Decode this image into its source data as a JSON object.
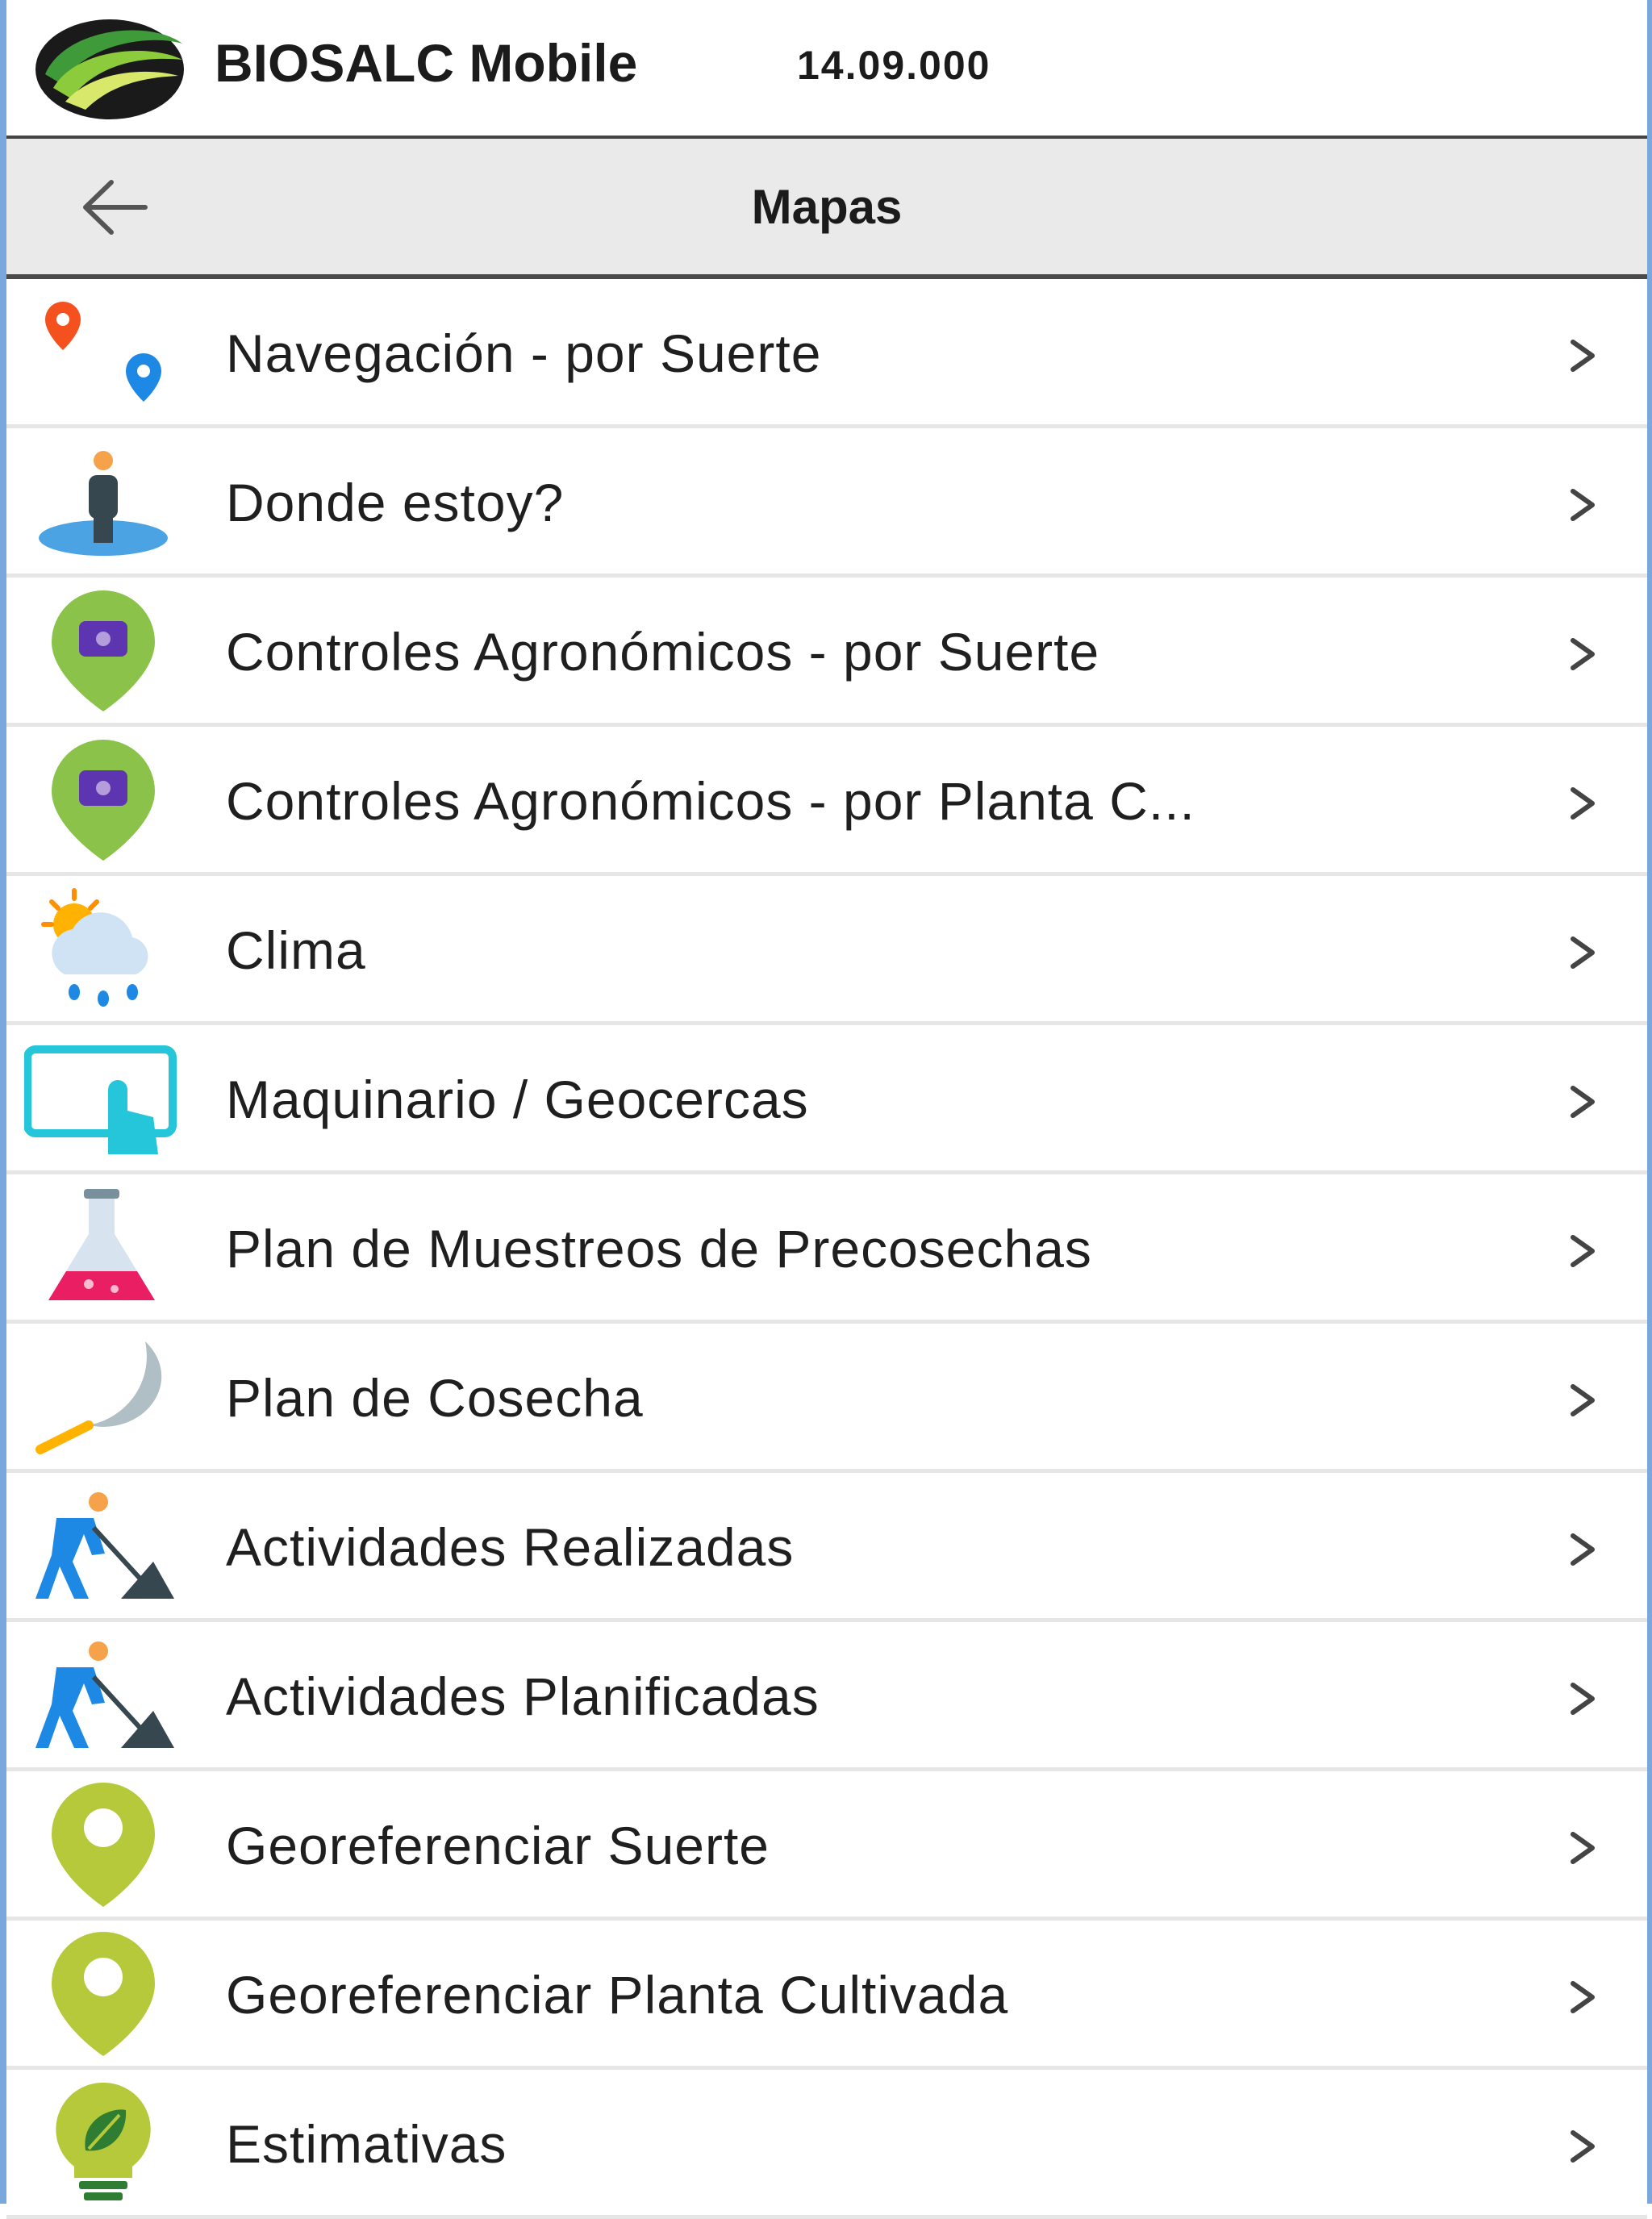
{
  "app": {
    "title": "BIOSALC Mobile",
    "version": "14.09.000"
  },
  "toolbar": {
    "title": "Mapas",
    "back_icon": "arrow-left-icon"
  },
  "menu": {
    "items": [
      {
        "label": "Navegación - por Suerte",
        "icon": "map-pins-icon"
      },
      {
        "label": "Donde estoy?",
        "icon": "person-location-icon"
      },
      {
        "label": "Controles Agronómicos - por Suerte",
        "icon": "green-pin-camera-icon"
      },
      {
        "label": "Controles Agronómicos - por Planta C...",
        "icon": "green-pin-camera-icon"
      },
      {
        "label": "Clima",
        "icon": "weather-icon"
      },
      {
        "label": "Maquinario / Geocercas",
        "icon": "touch-screen-icon"
      },
      {
        "label": "Plan de Muestreos de Precosechas",
        "icon": "flask-icon"
      },
      {
        "label": "Plan de Cosecha",
        "icon": "sickle-icon"
      },
      {
        "label": "Actividades Realizadas",
        "icon": "worker-shovel-icon"
      },
      {
        "label": "Actividades Planificadas",
        "icon": "worker-shovel-icon"
      },
      {
        "label": "Georeferenciar Suerte",
        "icon": "lime-pin-icon"
      },
      {
        "label": "Georeferenciar Planta Cultivada",
        "icon": "lime-pin-icon"
      },
      {
        "label": "Estimativas",
        "icon": "lightbulb-leaf-icon"
      }
    ]
  },
  "colors": {
    "toolbar_bg": "#eaeaea",
    "pin_green": "#8bc34a",
    "pin_lime": "#b5c93a",
    "accent_blue": "#1e88e5"
  }
}
